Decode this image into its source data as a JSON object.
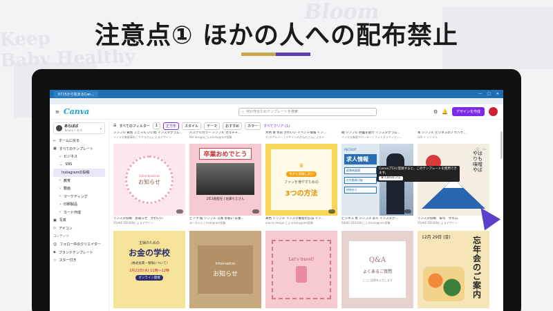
{
  "headline": "注意点① ほかの人への配布禁止",
  "background_text": [
    "Keep",
    "Baby Healthy",
    "Bloom"
  ],
  "browser": {
    "tab_title": "0715から始まるCan...",
    "window_controls": [
      "—",
      "□",
      "✕"
    ]
  },
  "canva": {
    "logo": "Canva",
    "search_placeholder": "何か作るためテンプレートを検索",
    "create_button": "デザインを作成"
  },
  "sidebar": {
    "account_name": "あらばば",
    "account_sub": "Teamv • 名 4",
    "items": [
      {
        "label": "ホームに戻る",
        "icon": "←",
        "level": 0
      },
      {
        "label": "すべてのテンプレート",
        "icon": "▦",
        "level": 0
      },
      {
        "label": "ビジネス",
        "icon": "›",
        "level": 1
      },
      {
        "label": "SNS",
        "icon": "⌄",
        "level": 1
      },
      {
        "label": "Instagramの投稿",
        "icon": "",
        "level": 2,
        "active": true
      },
      {
        "label": "教育",
        "icon": "›",
        "level": 1
      },
      {
        "label": "動画",
        "icon": "›",
        "level": 1
      },
      {
        "label": "マーケティング",
        "icon": "›",
        "level": 1
      },
      {
        "label": "印刷製品",
        "icon": "›",
        "level": 1
      },
      {
        "label": "カード作成",
        "icon": "›",
        "level": 1
      },
      {
        "label": "写真",
        "icon": "▣",
        "level": 0
      },
      {
        "label": "アイコン",
        "icon": "◇",
        "level": 0
      }
    ],
    "section_heading": "コンテンツ",
    "items2": [
      {
        "label": "フォロー中のクリエイター",
        "icon": "☺"
      },
      {
        "label": "ブランドテンプレート",
        "icon": "◈"
      },
      {
        "label": "スター付き",
        "icon": "☆"
      }
    ]
  },
  "filters": {
    "all": "すべてのフィルター",
    "count": "1",
    "chips": [
      "正方形",
      "スタイル",
      "テーマ",
      "おすすめ",
      "カラー"
    ],
    "clear": "すべてクリア (1)"
  },
  "top_meta": [
    {
      "title": "シンプル 黄色 ミニマル いいね インスタグラム...",
      "author": "インスタ集客専科 | サクラさんによるデザイン"
    },
    {
      "title": "パステルカラー シンプル カルチャ...",
      "author": "MH designによるInstagram投稿"
    },
    {
      "title": "水色 青 水彩 かわいい イベント情報 イン...",
      "author": "ガ·のアルバー | デザインのおねださんによるデ..."
    },
    {
      "title": "緑 シンプル 貯蓄を紹介 インスタグラム...",
      "author": "インスタ集客サポーター | フォトグラフィカン..."
    },
    {
      "title": "青 シンプル ビジネスのノウハウ...",
      "author": "Gift + ミニマル"
    }
  ],
  "row1": [
    {
      "kind": "info",
      "sub": "Information",
      "main": "お知らせ"
    },
    {
      "kind": "grad",
      "banner": "卒業おめでとう",
      "caption": "2年3組担任 | 佐藤ちえさん"
    },
    {
      "kind": "three",
      "tag": "今すぐ実践したい",
      "sub": "ファンを増やすための",
      "main": "3つの方法"
    },
    {
      "kind": "recruit",
      "tag": "RECRUIT",
      "main": "求人情報",
      "items": [
        "経験者優遇",
        "在宅勤務可能",
        "研修あり"
      ]
    },
    {
      "kind": "fuji",
      "vertical": "やはりも味噌 やば"
    }
  ],
  "row1_meta": [
    {
      "title": "インスタ投稿　お知らせ　かわいい",
      "author": "YOAKE DESIGNによるデザイン"
    },
    {
      "title": "ピンク 桜 シンプル 写真 お祝い 卒業...",
      "author": "みーちゃん | Instagram投稿"
    },
    {
      "title": "黄色 シンプル インスタ集客の方法 イン...",
      "author": "aaa-ta design によるInstagram投稿"
    },
    {
      "title": "ビジネス 青 シンプル 求人 インスタグ...",
      "author": "RIKKO DESIGN によるInstagram投稿"
    },
    {
      "title": "インスタ投稿　俳句　ボエム",
      "author": "YOAKE DESIGNによるデザイン"
    }
  ],
  "row2": [
    {
      "kind": "money",
      "s": "主婦のための",
      "b": "お金の学校",
      "c": "〈株式投資・保険について〉",
      "d": "2月22日(水) 11時〜12時",
      "e": "オンライン開催"
    },
    {
      "kind": "kraft",
      "s": "Information",
      "b": "お知らせ"
    },
    {
      "kind": "travel",
      "l": "Let's travel!"
    },
    {
      "kind": "qa",
      "q": "Q&A",
      "l": "よくあるご質問",
      "s": "ここに回答を入力します"
    },
    {
      "kind": "party",
      "date": "12月 29日 (金)",
      "title": "忘年会のご案内"
    }
  ],
  "row2_meta": [
    {
      "title": "イエロー 水色 シンプル お金の学...",
      "author": ""
    },
    {
      "title": "黄色 ミモザ クラフト シンプル お知らせ...",
      "author": ""
    },
    {
      "title": "ピンク 線 日本一周 旅行 インスタ...",
      "author": ""
    },
    {
      "title": "桃姫 Q&A テキスト くすみピンク...",
      "author": ""
    },
    {
      "title": "赤色 オレンジ 黄色 忘年会...",
      "author": ""
    }
  ],
  "tooltip": {
    "text": "Canvaプロに登録すると、このテンプレートを使用できます。",
    "button": "♛ Canvaプロ"
  },
  "colors": {
    "accent": "#7d2ae8",
    "headline_gold": "#c9a84c",
    "headline_purple": "#5a3fb4"
  }
}
